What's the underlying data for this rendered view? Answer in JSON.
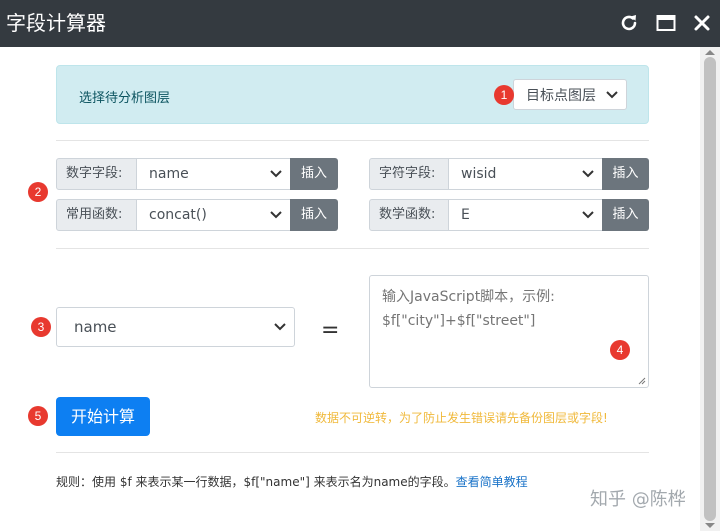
{
  "window": {
    "title": "字段计算器"
  },
  "layer": {
    "label": "选择待分析图层",
    "selected": "目标点图层"
  },
  "badges": [
    "1",
    "2",
    "3",
    "4",
    "5"
  ],
  "groups": {
    "numeric_field": {
      "label": "数字字段:",
      "value": "name",
      "button": "插入"
    },
    "string_field": {
      "label": "字符字段:",
      "value": "wisid",
      "button": "插入"
    },
    "common_func": {
      "label": "常用函数:",
      "value": "concat()",
      "button": "插入"
    },
    "math_func": {
      "label": "数学函数:",
      "value": "E",
      "button": "插入"
    }
  },
  "target_field": {
    "value": "name"
  },
  "equals": "=",
  "script": {
    "placeholder": "输入JavaScript脚本，示例:\n$f[\"city\"]+$f[\"street\"]"
  },
  "actions": {
    "start": "开始计算",
    "warning": "数据不可逆转，为了防止发生错误请先备份图层或字段!"
  },
  "rules": {
    "text": "规则：使用 $f 来表示某一行数据，$f[\"name\"] 来表示名为name的字段。",
    "link": "查看简单教程"
  },
  "watermark": "知乎 @陈桦",
  "colors": {
    "titlebar": "#343a40",
    "panel": "#d1ecf1",
    "badge": "#e8392f",
    "primary": "#0d7ff2",
    "secondary_button": "#6c757d",
    "warning_text": "#f0b93b"
  }
}
